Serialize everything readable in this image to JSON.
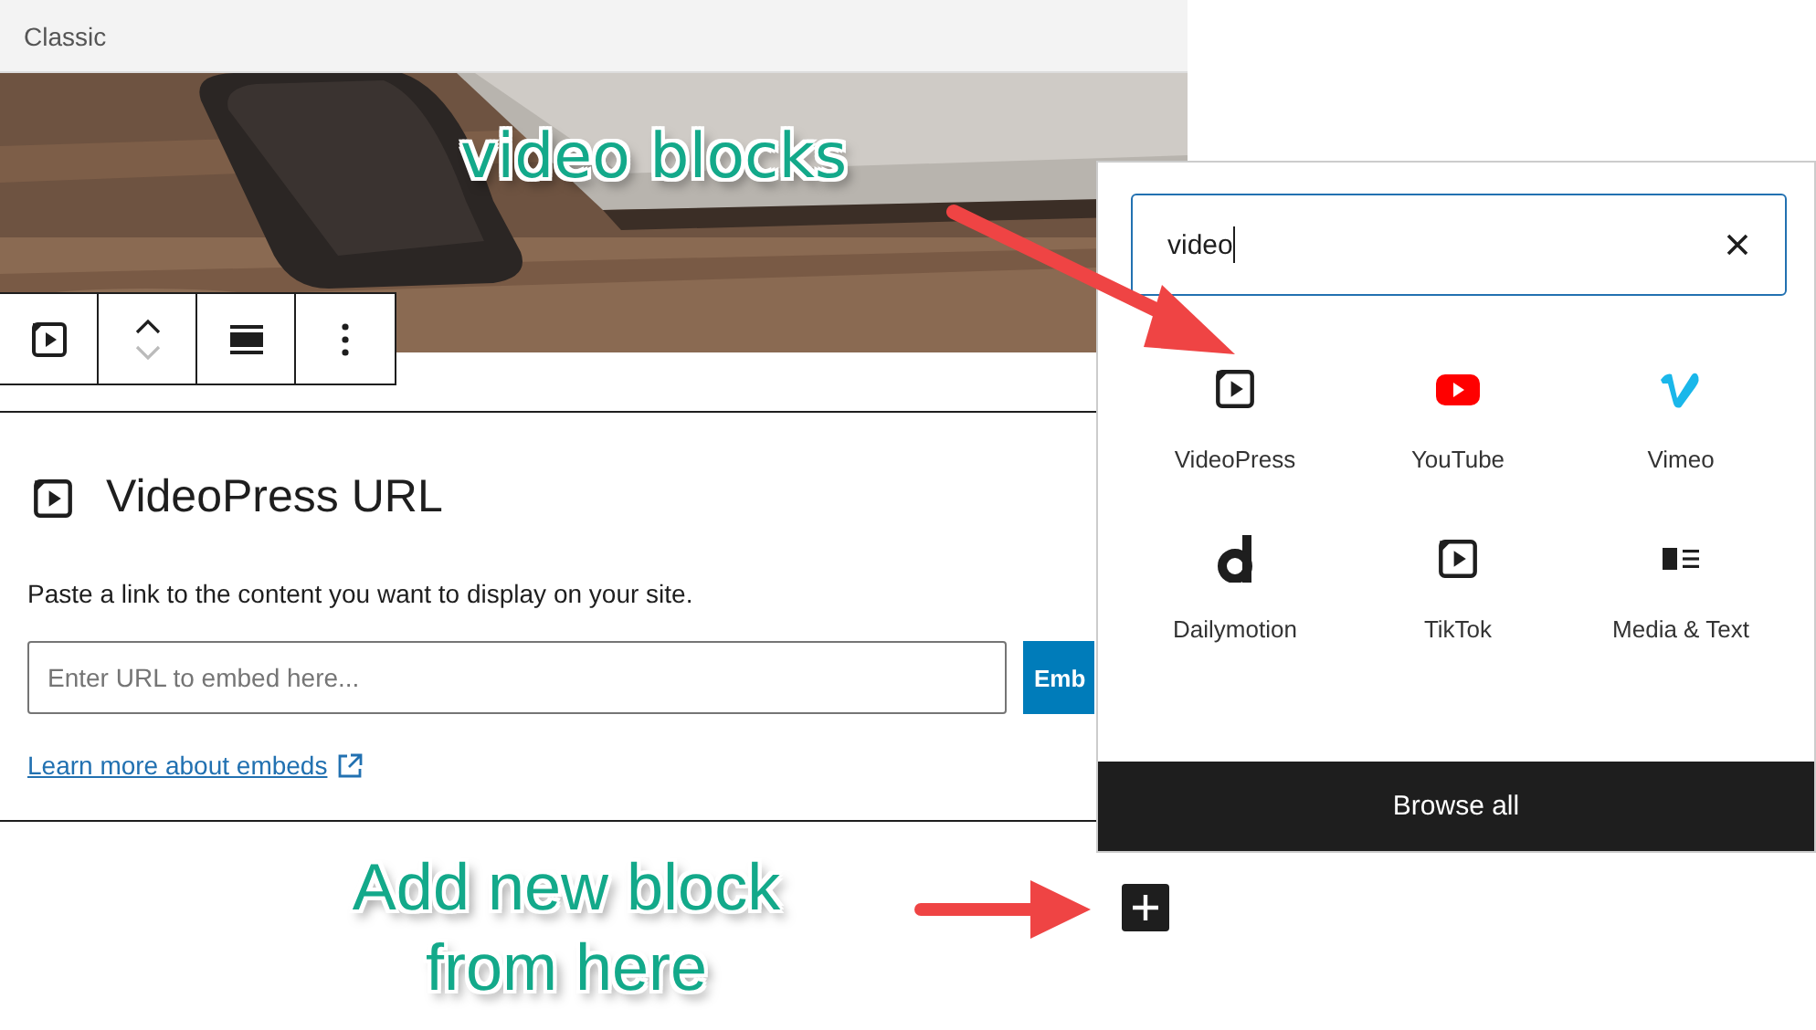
{
  "top_bar": {
    "label": "Classic"
  },
  "block_toolbar": {
    "buttons": [
      {
        "kind": "video"
      },
      {
        "kind": "move"
      },
      {
        "kind": "align"
      },
      {
        "kind": "more"
      }
    ]
  },
  "embed_block": {
    "title": "VideoPress URL",
    "description": "Paste a link to the content you want to display on your site.",
    "url_field": {
      "placeholder": "Enter URL to embed here..."
    },
    "embed_button": "Emb",
    "learn_more_link": "Learn more about embeds"
  },
  "inserter": {
    "search": {
      "value": "video"
    },
    "blocks": [
      {
        "label": "VideoPress",
        "kind": "video"
      },
      {
        "label": "YouTube",
        "kind": "youtube"
      },
      {
        "label": "Vimeo",
        "kind": "vimeo"
      },
      {
        "label": "Dailymotion",
        "kind": "dailymotion"
      },
      {
        "label": "TikTok",
        "kind": "video"
      },
      {
        "label": "Media & Text",
        "kind": "media-text"
      }
    ],
    "browse_all": "Browse all"
  },
  "annotations": [
    {
      "text": "video blocks",
      "kind": "top"
    },
    {
      "text": "Add new block from here",
      "kind": "bottom"
    }
  ]
}
